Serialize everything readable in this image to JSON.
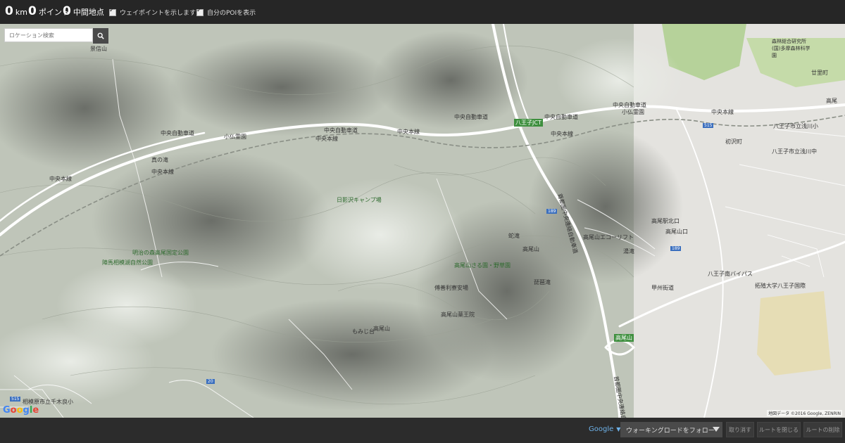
{
  "topbar": {
    "distance": {
      "value": "0",
      "unit": "km"
    },
    "points": {
      "value": "0",
      "unit": "ポイント"
    },
    "waypoints": {
      "value": "0",
      "unit": "中間地点"
    },
    "show_waypoints": {
      "label": "ウェイポイントを示します",
      "checked": true
    },
    "show_my_poi": {
      "label": "自分のPOIを表示",
      "checked": true
    }
  },
  "search": {
    "placeholder": "ロケーション検索",
    "icon": "search-icon"
  },
  "map": {
    "labels": {
      "jinba": "景信山",
      "chuo_expy_1": "中央自動車道",
      "chuo_expy_2": "中央自動車道",
      "chuo_expy_3": "中央自動車道",
      "chuo_expy_4": "中央自動車道",
      "chuo_expy_5": "中央自動車道",
      "chuo_line_1": "中央本線",
      "chuo_line_2": "中央本線",
      "chuo_line_3": "中央本線",
      "chuo_line_4": "中央本線",
      "chuo_line_5": "中央本線",
      "chuo_line_6": "中央本線",
      "kobotoke_reien": "小仏霊園",
      "kobotoke": "小仏霊園",
      "hanyaji": "真の滝",
      "hikage": "日影沢キャンプ場",
      "meiji_park": "明治の森高尾国定公園",
      "jinba_park": "陣馬相模湖自然公園",
      "hachioji_jct": "八王子JCT",
      "takaosan_saru": "高尾山さる園・野草園",
      "takaosan": "高尾山",
      "takaosan_summit": "高尾山",
      "momiji": "もみじ台",
      "yakuoin": "高尾山薬王院",
      "hashita": "蛇滝",
      "biwa": "琵琶滝",
      "jorakuin": "傅善利寮安場",
      "takao_ic": "高尾山",
      "takaosanguchi": "高尾山口",
      "ryuzu": "高尾山エコーリフト",
      "ina": "湯滝",
      "morinoken": "森林総合研究所(国)多摩森林科学園",
      "takao_station": "高尾",
      "hachioji_bypass": "八王子南バイパス",
      "takaomachi": "初沢町",
      "takuiryo": "拓殖大学八王子国際",
      "tomi": "廿里町",
      "kita_ohashi": "八王子市立浅川中",
      "sagami": "相模原市立千木良小",
      "hatsuzawa": "八王子市立浅川小",
      "kenbu": "首都圏中央連絡自動車道",
      "kenbu2": "首都圏中央連絡自動車道",
      "road_20": "20",
      "road_515": "515",
      "road_189": "189",
      "takao_bus": "高尾駅北口",
      "hachioji_kita": "八王子市立浅川中",
      "koryo": "甲州街道"
    }
  },
  "google_logo": "Google",
  "credit": "地図データ ©2016 Google, ZENRIN",
  "bottombar": {
    "map_type": "Google",
    "follow_label": "ウォーキングロードをフォロー",
    "undo": "取り消す",
    "close_route": "ルートを閉じる",
    "delete_route": "ルートの削除"
  },
  "colors": {
    "topbar": "#262626",
    "bottombar": "#2c2c2c",
    "link": "#6fb3ea"
  }
}
